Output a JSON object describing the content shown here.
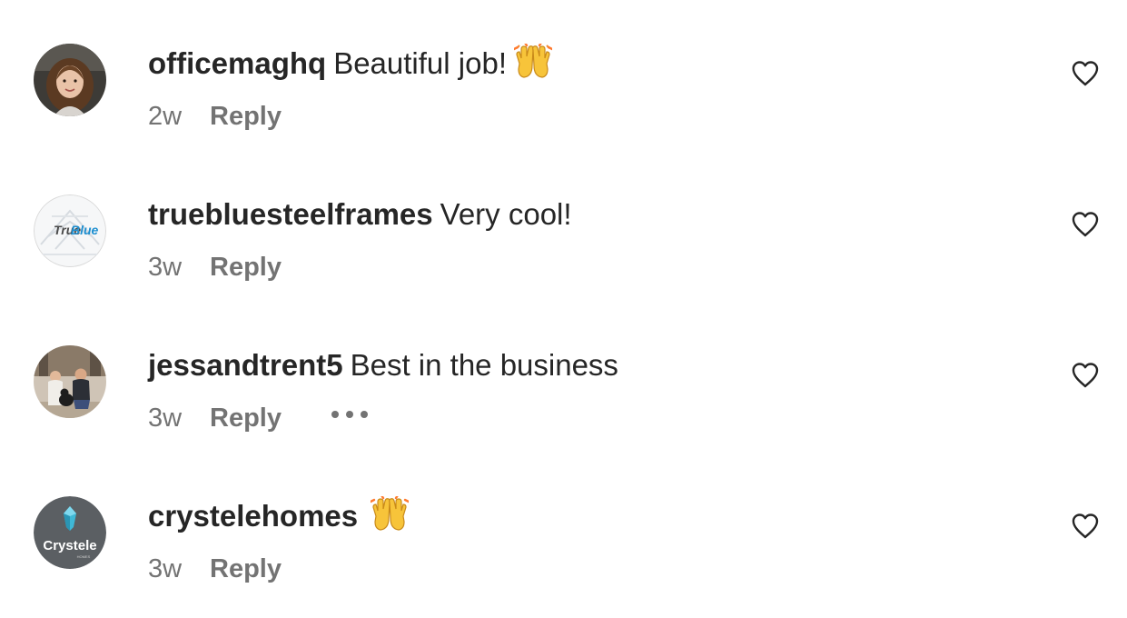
{
  "comments": [
    {
      "username": "officemaghq",
      "text": "Beautiful job!",
      "emoji": "raising-hands-emoji",
      "time": "2w",
      "reply_label": "Reply",
      "avatar": "woman-portrait-avatar"
    },
    {
      "username": "truebluesteelframes",
      "text": "Very cool!",
      "emoji": "",
      "time": "3w",
      "reply_label": "Reply",
      "avatar": "trueblue-logo-avatar",
      "avatar_logo_text_a": "True",
      "avatar_logo_text_b": "Blue"
    },
    {
      "username": "jessandtrent5",
      "text": "Best in the business",
      "emoji": "",
      "time": "3w",
      "reply_label": "Reply",
      "avatar": "couple-with-dogs-avatar",
      "more_icon": "more-options-icon"
    },
    {
      "username": "crystelehomes",
      "text": "",
      "emoji": "raising-hands-emoji",
      "time": "3w",
      "reply_label": "Reply",
      "avatar": "crystele-logo-avatar",
      "avatar_logo_text": "Crystele",
      "avatar_logo_subtext": "HOMES"
    }
  ],
  "icons": {
    "like": "heart-outline-icon"
  },
  "colors": {
    "text": "#262626",
    "secondary": "#737373",
    "background": "#ffffff"
  }
}
